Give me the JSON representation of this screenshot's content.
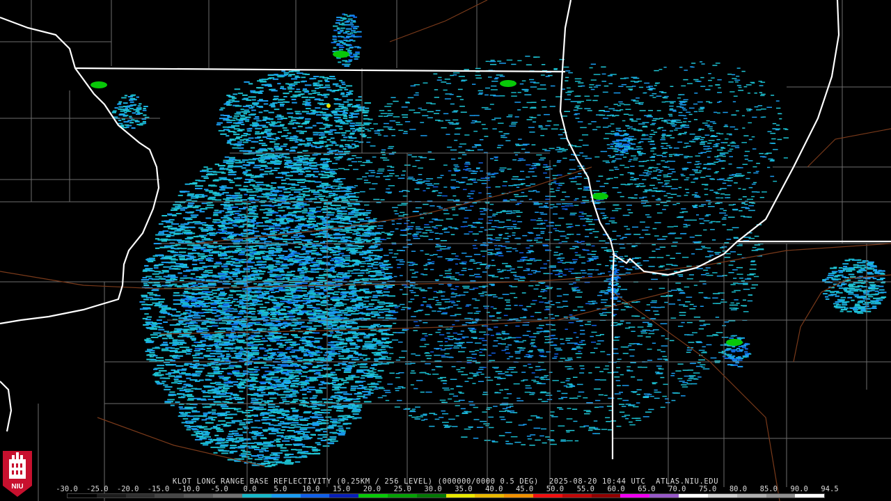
{
  "caption": {
    "station": "KLOT LONG RANGE BASE REFLECTIVITY (0.25KM / 256 LEVEL) (000000/0000 0.5 DEG)",
    "timestamp": "2025-08-20 10:44 UTC",
    "site": "ATLAS.NIU.EDU"
  },
  "scale": {
    "labels": [
      "-30.0",
      "-25.0",
      "-20.0",
      "-15.0",
      "-10.0",
      "-5.0",
      "0.0",
      "5.0",
      "10.0",
      "15.0",
      "20.0",
      "25.0",
      "30.0",
      "35.0",
      "40.0",
      "45.0",
      "50.0",
      "55.0",
      "60.0",
      "65.0",
      "70.0",
      "75.0",
      "80.0",
      "85.0",
      "90.0",
      "94.5"
    ],
    "colors": [
      "#000000",
      "#1c1c1c",
      "#303030",
      "#464646",
      "#5c5c5c",
      "#727272",
      "#18b8c8",
      "#1a9cf0",
      "#1060e8",
      "#0820b8",
      "#08c808",
      "#05a005",
      "#047804",
      "#e8e800",
      "#e8b800",
      "#f09000",
      "#f01010",
      "#c00808",
      "#900000",
      "#f000f0",
      "#9858c8",
      "#ffffff",
      "#d0d0d0",
      "#b0b0b0",
      "#909090",
      "#ffffff"
    ]
  },
  "logo": {
    "text": "NIU"
  }
}
